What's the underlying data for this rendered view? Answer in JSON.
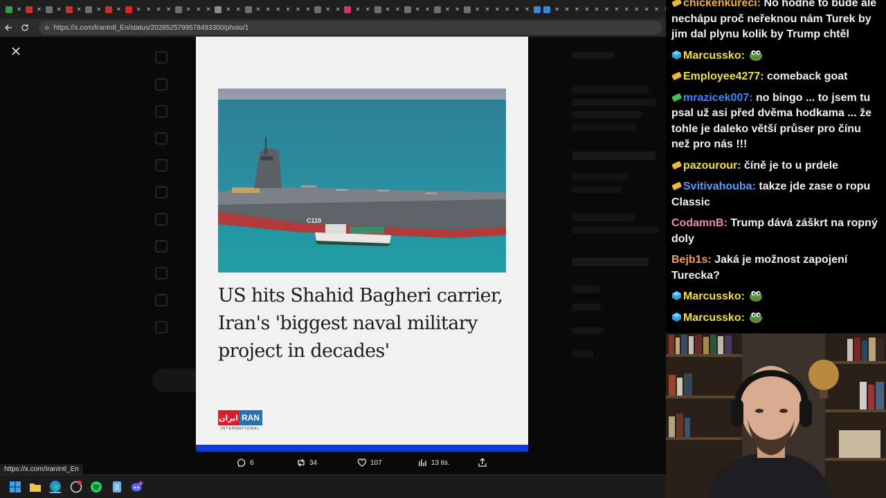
{
  "browser": {
    "tab_icons": [
      "green",
      "x",
      "red",
      "x",
      "grey",
      "x",
      "red",
      "x",
      "grey",
      "x",
      "red",
      "x",
      "yt",
      "x",
      "x",
      "x",
      "x",
      "grey",
      "x",
      "x",
      "x",
      "w",
      "x",
      "x",
      "grey",
      "x",
      "x",
      "x",
      "x",
      "x",
      "x",
      "grey",
      "x",
      "x",
      "insta",
      "x",
      "x",
      "grey",
      "x",
      "x",
      "grey",
      "x",
      "x",
      "grey",
      "x",
      "x",
      "grey",
      "x",
      "x",
      "x",
      "x",
      "x",
      "x",
      "search",
      "search",
      "x",
      "x",
      "x",
      "x",
      "x",
      "x",
      "x",
      "x",
      "x",
      "x",
      "x",
      "x",
      "x",
      "x"
    ],
    "url": "https://x.com/IranIntl_En/status/2028525799578493300/photo/1",
    "back_icon": "arrow-left-icon",
    "reload_icon": "reload-icon"
  },
  "media": {
    "headline": "US hits Shahid Bagheri carrier, Iran's 'biggest naval military project in decades'",
    "hull_number": "C110",
    "logo": {
      "farsi": "ایران",
      "latin": "RAN",
      "sub": "INTERNATIONAL"
    }
  },
  "actions": {
    "replies": "6",
    "reposts": "34",
    "likes": "107",
    "views": "13 tis."
  },
  "status_url": "https://x.com/IranIntl_En",
  "colors": {
    "card_bar": "#0f3bd6",
    "chat_bg": "#000000"
  },
  "chat": [
    {
      "user": "chickenkurecí:",
      "color": "#f0b33b",
      "badge": "sub-gold",
      "text": "No hodně to bude ale nechápu proč neřeknou nám Turek by jim dal plynu kolik by Trump chtěl",
      "emote": false
    },
    {
      "user": "Marcussko:",
      "color": "#f2e04a",
      "badge": "blue-gem",
      "text": "",
      "emote": true
    },
    {
      "user": "Employee4277:",
      "color": "#f2e04a",
      "badge": "sub-gold",
      "text": "comeback goat",
      "emote": false
    },
    {
      "user": "mrazicek007:",
      "color": "#3f86ff",
      "badge": "sub-green",
      "text": "no bingo ... to jsem tu psal už asi před dvěma hodkama ... že tohle je daleko větší průser pro čínu než pro nás !!!",
      "emote": false
    },
    {
      "user": "pazourour:",
      "color": "#f2e04a",
      "badge": "sub-gold",
      "text": "číně je to u prdele",
      "emote": false
    },
    {
      "user": "Svitivahouba:",
      "color": "#5b9cff",
      "badge": "sub-gold",
      "text": "takze jde zase o ropu Classic",
      "emote": false
    },
    {
      "user": "CodamnB:",
      "color": "#f08ba8",
      "badge": "",
      "text": "Trump dává záškrt na ropný doly",
      "emote": false
    },
    {
      "user": "Bejb1s:",
      "color": "#f0a05a",
      "badge": "",
      "text": "Jaká je možnost zapojení Turecka?",
      "emote": false
    },
    {
      "user": "Marcussko:",
      "color": "#f2e04a",
      "badge": "blue-gem",
      "text": "",
      "emote": true
    },
    {
      "user": "Marcussko:",
      "color": "#f2e04a",
      "badge": "blue-gem",
      "text": "",
      "emote": true
    }
  ]
}
